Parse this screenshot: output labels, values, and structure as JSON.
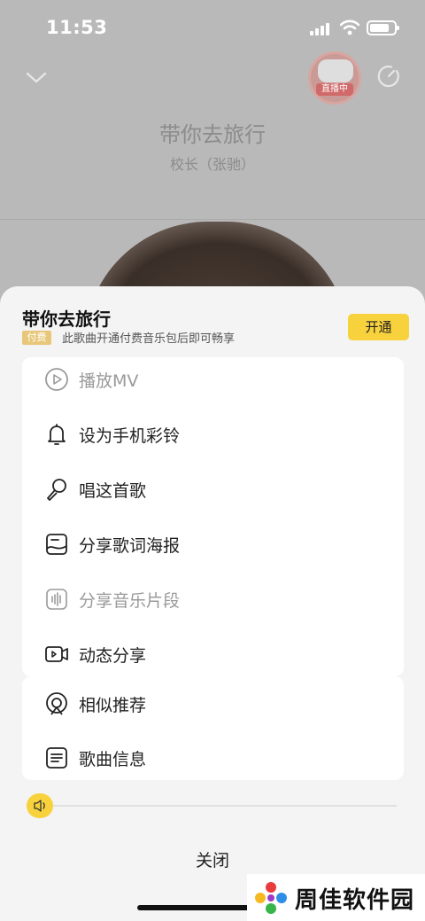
{
  "status": {
    "time": "11:53"
  },
  "player": {
    "title": "带你去旅行",
    "artist": "校长（张驰）",
    "live_badge": "直播中"
  },
  "sheet": {
    "title": "带你去旅行",
    "paid_tag": "付费",
    "paid_note": "此歌曲开通付费音乐包后即可畅享",
    "open_button": "开通",
    "menu": [
      {
        "label": "播放MV",
        "icon": "play-mv-icon",
        "enabled": false
      },
      {
        "label": "设为手机彩铃",
        "icon": "bell-icon",
        "enabled": true
      },
      {
        "label": "唱这首歌",
        "icon": "microphone-icon",
        "enabled": true
      },
      {
        "label": "分享歌词海报",
        "icon": "lyrics-poster-icon",
        "enabled": true
      },
      {
        "label": "分享音乐片段",
        "icon": "waveform-icon",
        "enabled": false
      },
      {
        "label": "动态分享",
        "icon": "video-camera-icon",
        "enabled": true
      }
    ],
    "menu2": [
      {
        "label": "相似推荐",
        "icon": "similar-icon",
        "enabled": true
      },
      {
        "label": "歌曲信息",
        "icon": "info-list-icon",
        "enabled": true
      }
    ],
    "close_button": "关闭",
    "volume": 0.0
  },
  "watermark": {
    "text": "周佳软件园"
  },
  "colors": {
    "accent": "#f8d23c",
    "paid_tag": "#e8c77a"
  }
}
